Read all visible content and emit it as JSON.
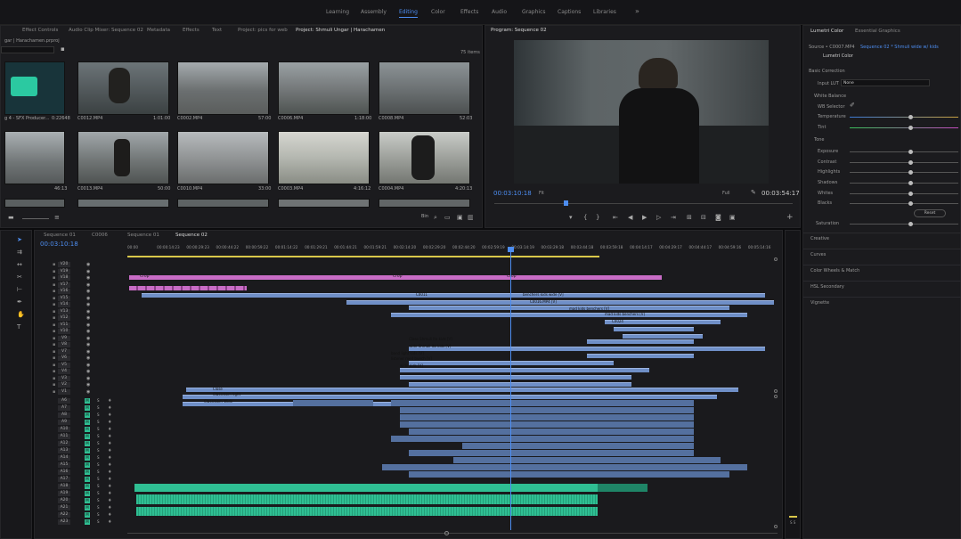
{
  "workspaces": [
    "Learning",
    "Assembly",
    "Editing",
    "Color",
    "Effects",
    "Audio",
    "Graphics",
    "Captions",
    "Libraries"
  ],
  "workspace_overflow": "»",
  "project_panel": {
    "tabs": [
      "Effect Controls",
      "Audio Clip Mixer: Sequence 02",
      "Metadata",
      "Effects",
      "Text",
      "Project: pics for web",
      "Project: Shmuli Ungar | Harachamen"
    ],
    "path": "gar | Harachamen.prproj",
    "items_count": "75 items",
    "clips": [
      {
        "name": "g 4 - SFX Producer...",
        "duration": "0:22648"
      },
      {
        "name": "C0012.MP4",
        "duration": "1:01:00"
      },
      {
        "name": "C0002.MP4",
        "duration": "57:00"
      },
      {
        "name": "C0006.MP4",
        "duration": "1:18:00"
      },
      {
        "name": "C0008.MP4",
        "duration": "52:03"
      },
      {
        "name": "",
        "duration": "46:13"
      },
      {
        "name": "C0013.MP4",
        "duration": "50:00"
      },
      {
        "name": "C0010.MP4",
        "duration": "33:00"
      },
      {
        "name": "C0003.MP4",
        "duration": "4:16:12"
      },
      {
        "name": "C0004.MP4",
        "duration": "4:20:13"
      }
    ]
  },
  "program_monitor": {
    "title": "Program: Sequence 02",
    "timecode_in": "00:03:10:18",
    "fit": "Fit",
    "quality": "Full",
    "timecode_out": "00:03:54:17"
  },
  "lumetri": {
    "tabs": [
      "Lumetri Color",
      "Essential Graphics"
    ],
    "source": "Source • C0007.MP4",
    "sequence": "Sequence 02 * Shmuli wide w/ kids",
    "effect": "Lumetri Color",
    "basic_correction": "Basic Correction",
    "input_lut_label": "Input LUT",
    "input_lut_value": "None",
    "white_balance": "White Balance",
    "wb_selector": "WB Selector",
    "temperature": "Temperature",
    "tint": "Tint",
    "tone": "Tone",
    "tone_sliders": [
      "Exposure",
      "Contrast",
      "Highlights",
      "Shadows",
      "Whites",
      "Blacks"
    ],
    "reset": "Reset",
    "saturation": "Saturation",
    "sections": [
      "Creative",
      "Curves",
      "Color Wheels & Match",
      "HSL Secondary",
      "Vignette"
    ]
  },
  "timeline": {
    "tabs": [
      "Sequence 01",
      "C0006",
      "Sequence 01",
      "Sequence 02"
    ],
    "timecode": "00:03:10:18",
    "ruler": [
      "00:00",
      "00:00:14:23",
      "00:00:29:23",
      "00:00:44:22",
      "00:00:59:22",
      "00:01:14:22",
      "00:01:29:21",
      "00:01:44:21",
      "00:01:59:21",
      "00:02:14:20",
      "00:02:29:20",
      "00:02:44:20",
      "00:02:59:19",
      "00:03:14:19",
      "00:03:29:18",
      "00:03:44:18",
      "00:03:59:18",
      "00:04:14:17",
      "00:04:29:17",
      "00:04:44:17",
      "00:04:59:16",
      "00:05:14:16"
    ],
    "video_tracks": [
      "V20",
      "V19",
      "V18",
      "V17",
      "V16",
      "V15",
      "V14",
      "V13",
      "V12",
      "V11",
      "V10",
      "V9",
      "V8",
      "V7",
      "V6",
      "V5",
      "V4",
      "V3",
      "V2",
      "V1"
    ],
    "audio_tracks": [
      "A6",
      "A7",
      "A8",
      "A9",
      "A10",
      "A11",
      "A12",
      "A13",
      "A14",
      "A15",
      "A16",
      "A17",
      "A18",
      "A19",
      "A20",
      "A21",
      "A22",
      "A23"
    ],
    "clip_labels": [
      "Crop",
      "Crop",
      "Crop",
      "Crop",
      "C0011",
      "benchers kids wide [V]",
      "benchers kids wide [V]",
      "C0016.MP4 [V]",
      "mad kids benchers [V]",
      "mad kids benchers [V]",
      "C0024",
      "Close Shmuli Ito kids [V]",
      "wide Shmuli Ito kids [V]",
      "band light kids [V]",
      "listener med bunch [V]",
      "wide kids [V]",
      "Close",
      "Classroom light",
      "Classroom Wide",
      "Classroom Wide [V]"
    ],
    "master": "Master"
  }
}
